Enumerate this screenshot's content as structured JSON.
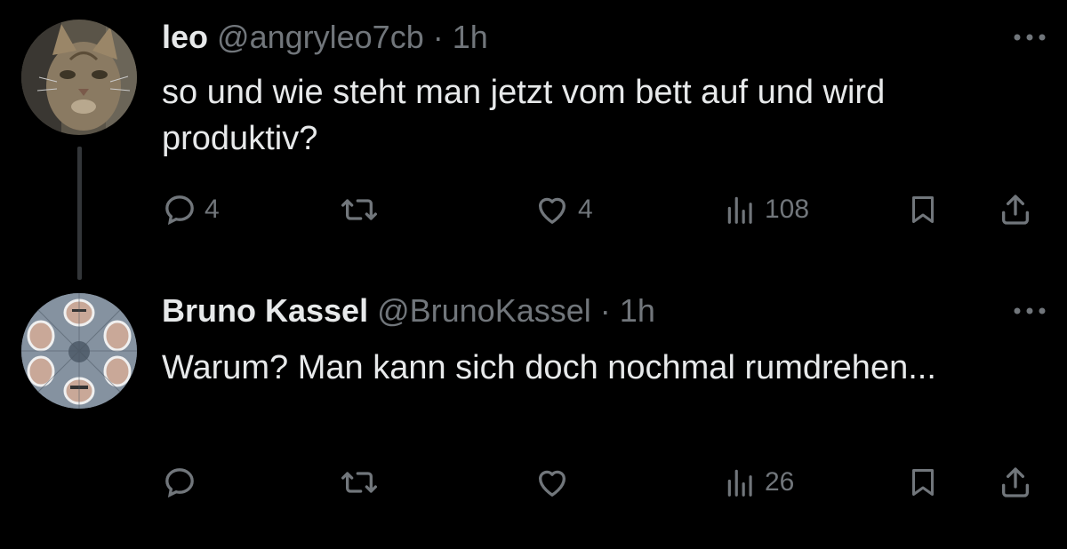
{
  "tweets": [
    {
      "name": "leo",
      "handle": "@angryleo7cb",
      "separator": "·",
      "time": "1h",
      "text": "so und wie steht man jetzt vom bett auf und wird produktiv?",
      "avatar_icon": "cat-avatar",
      "replies": "4",
      "reposts": "",
      "likes": "4",
      "views": "108"
    },
    {
      "name": "Bruno Kassel",
      "handle": "@BrunoKassel",
      "separator": "·",
      "time": "1h",
      "text": "Warum? Man kann sich doch nochmal rumdrehen...",
      "avatar_icon": "kaleidoscope-face-avatar",
      "replies": "",
      "reposts": "",
      "likes": "",
      "views": "26"
    }
  ],
  "colors": {
    "background": "#000000",
    "text": "#e7e9ea",
    "secondary": "#71767b",
    "thread_line": "#333639"
  }
}
